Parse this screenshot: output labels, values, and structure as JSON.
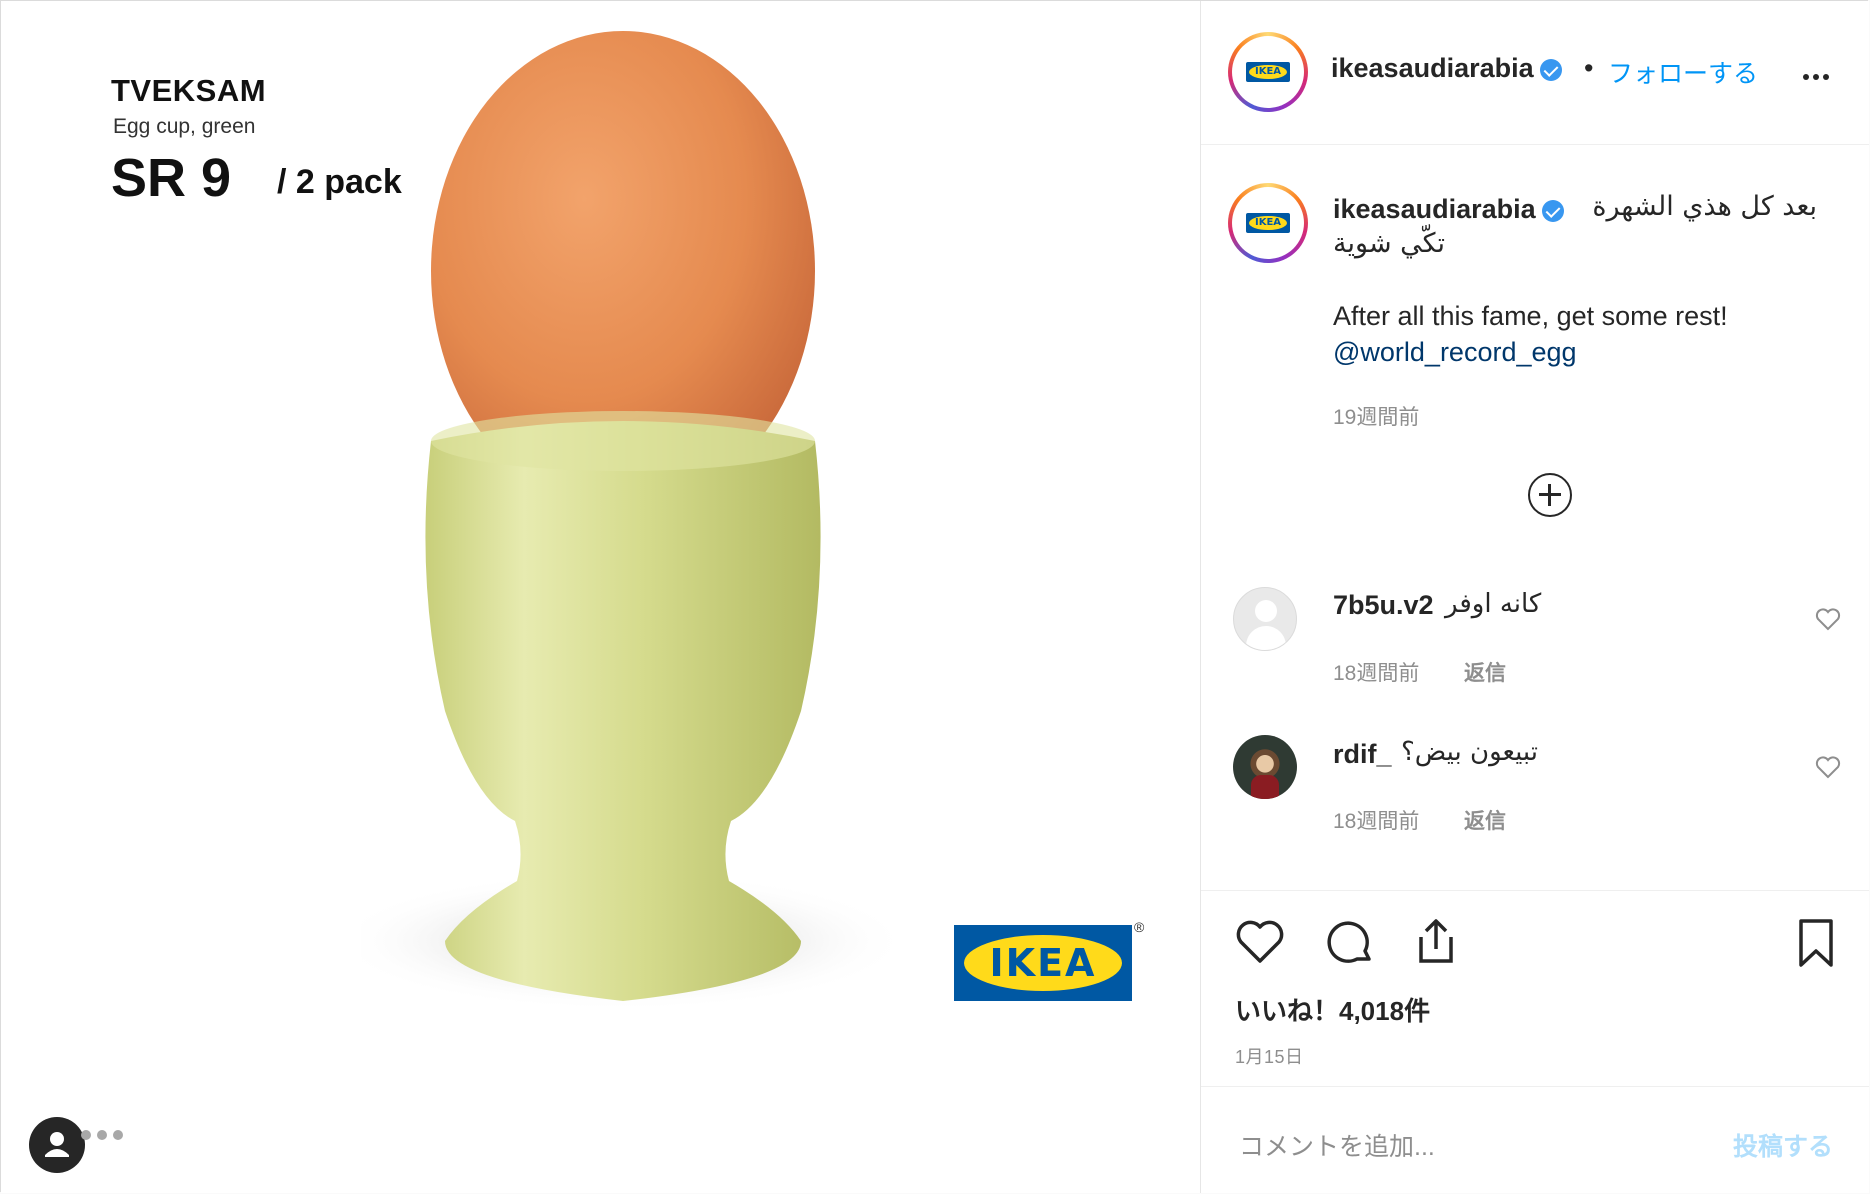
{
  "product": {
    "name": "TVEKSAM",
    "subtitle": "Egg cup, green",
    "price": "SR 9",
    "pack": "/ 2 pack",
    "brand_logo": "IKEA",
    "registered": "®"
  },
  "header": {
    "username": "ikeasaudiarabia",
    "separator": "•",
    "follow_label": "フォローする",
    "avatar_logo": "IKEA"
  },
  "caption": {
    "username": "ikeasaudiarabia",
    "arabic_line1": "بعد كل هذي الشهرة",
    "arabic_line2": "تكّي شوية",
    "english": "After all this fame, get some rest!",
    "mention": "@world_record_egg",
    "time": "19週間前"
  },
  "comments": [
    {
      "username": "7b5u.v2",
      "text": "كانه اوفر",
      "time": "18週間前",
      "reply": "返信"
    },
    {
      "username": "rdif_",
      "text": "تبيعون بيض؟",
      "time": "18週間前",
      "reply": "返信"
    }
  ],
  "actions": {
    "likes": "いいね！4,018件",
    "date": "1月15日"
  },
  "comment_box": {
    "placeholder": "コメントを追加...",
    "post_label": "投稿する"
  },
  "colors": {
    "accent": "#0095f6",
    "ikea_blue": "#0058a3",
    "ikea_yellow": "#ffda1a",
    "egg": "#e98d52",
    "cup": "#d3d98a"
  }
}
